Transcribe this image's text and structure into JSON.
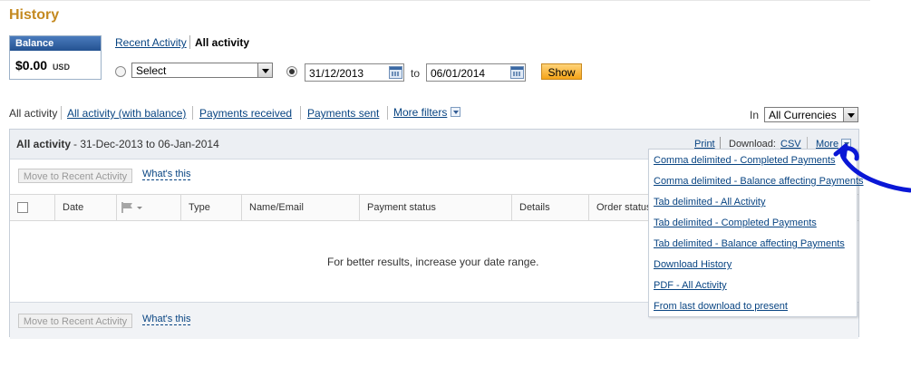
{
  "page": {
    "title": "History"
  },
  "balance": {
    "label": "Balance",
    "amount": "$0.00",
    "currency": "USD"
  },
  "view_tabs": {
    "recent": "Recent Activity",
    "all": "All activity"
  },
  "range": {
    "select_value": "Select",
    "from_date": "31/12/2013",
    "to_label": "to",
    "to_date": "06/01/2014",
    "show_label": "Show"
  },
  "filters": {
    "items": [
      "All activity",
      "All activity (with balance)",
      "Payments received",
      "Payments sent",
      "More filters"
    ],
    "in_label": "In",
    "currency_value": "All Currencies"
  },
  "panel": {
    "heading": "All activity",
    "date_range": "- 31-Dec-2013 to 06-Jan-2014",
    "print_label": "Print",
    "download_label": "Download:",
    "csv_label": "CSV",
    "more_label": "More",
    "move_label": "Move to Recent Activity",
    "whats_this": "What's this",
    "columns": [
      "Date",
      "Type",
      "Name/Email",
      "Payment status",
      "Details",
      "Order status"
    ],
    "empty_message": "For better results, increase your date range."
  },
  "download_menu": {
    "items": [
      "Comma delimited - Completed Payments",
      "Comma delimited - Balance affecting Payments",
      "Tab delimited - All Activity",
      "Tab delimited - Completed Payments",
      "Tab delimited - Balance affecting Payments",
      "Download History",
      "PDF - All Activity",
      "From last download to present"
    ]
  },
  "colors": {
    "title": "#c4891f",
    "link": "#084482",
    "annotation": "#0a17d6",
    "show_button": "#f5a418"
  },
  "icons": [
    "calendar-icon",
    "flag-icon",
    "chevron-down-icon",
    "dropdown-arrow-icon"
  ]
}
